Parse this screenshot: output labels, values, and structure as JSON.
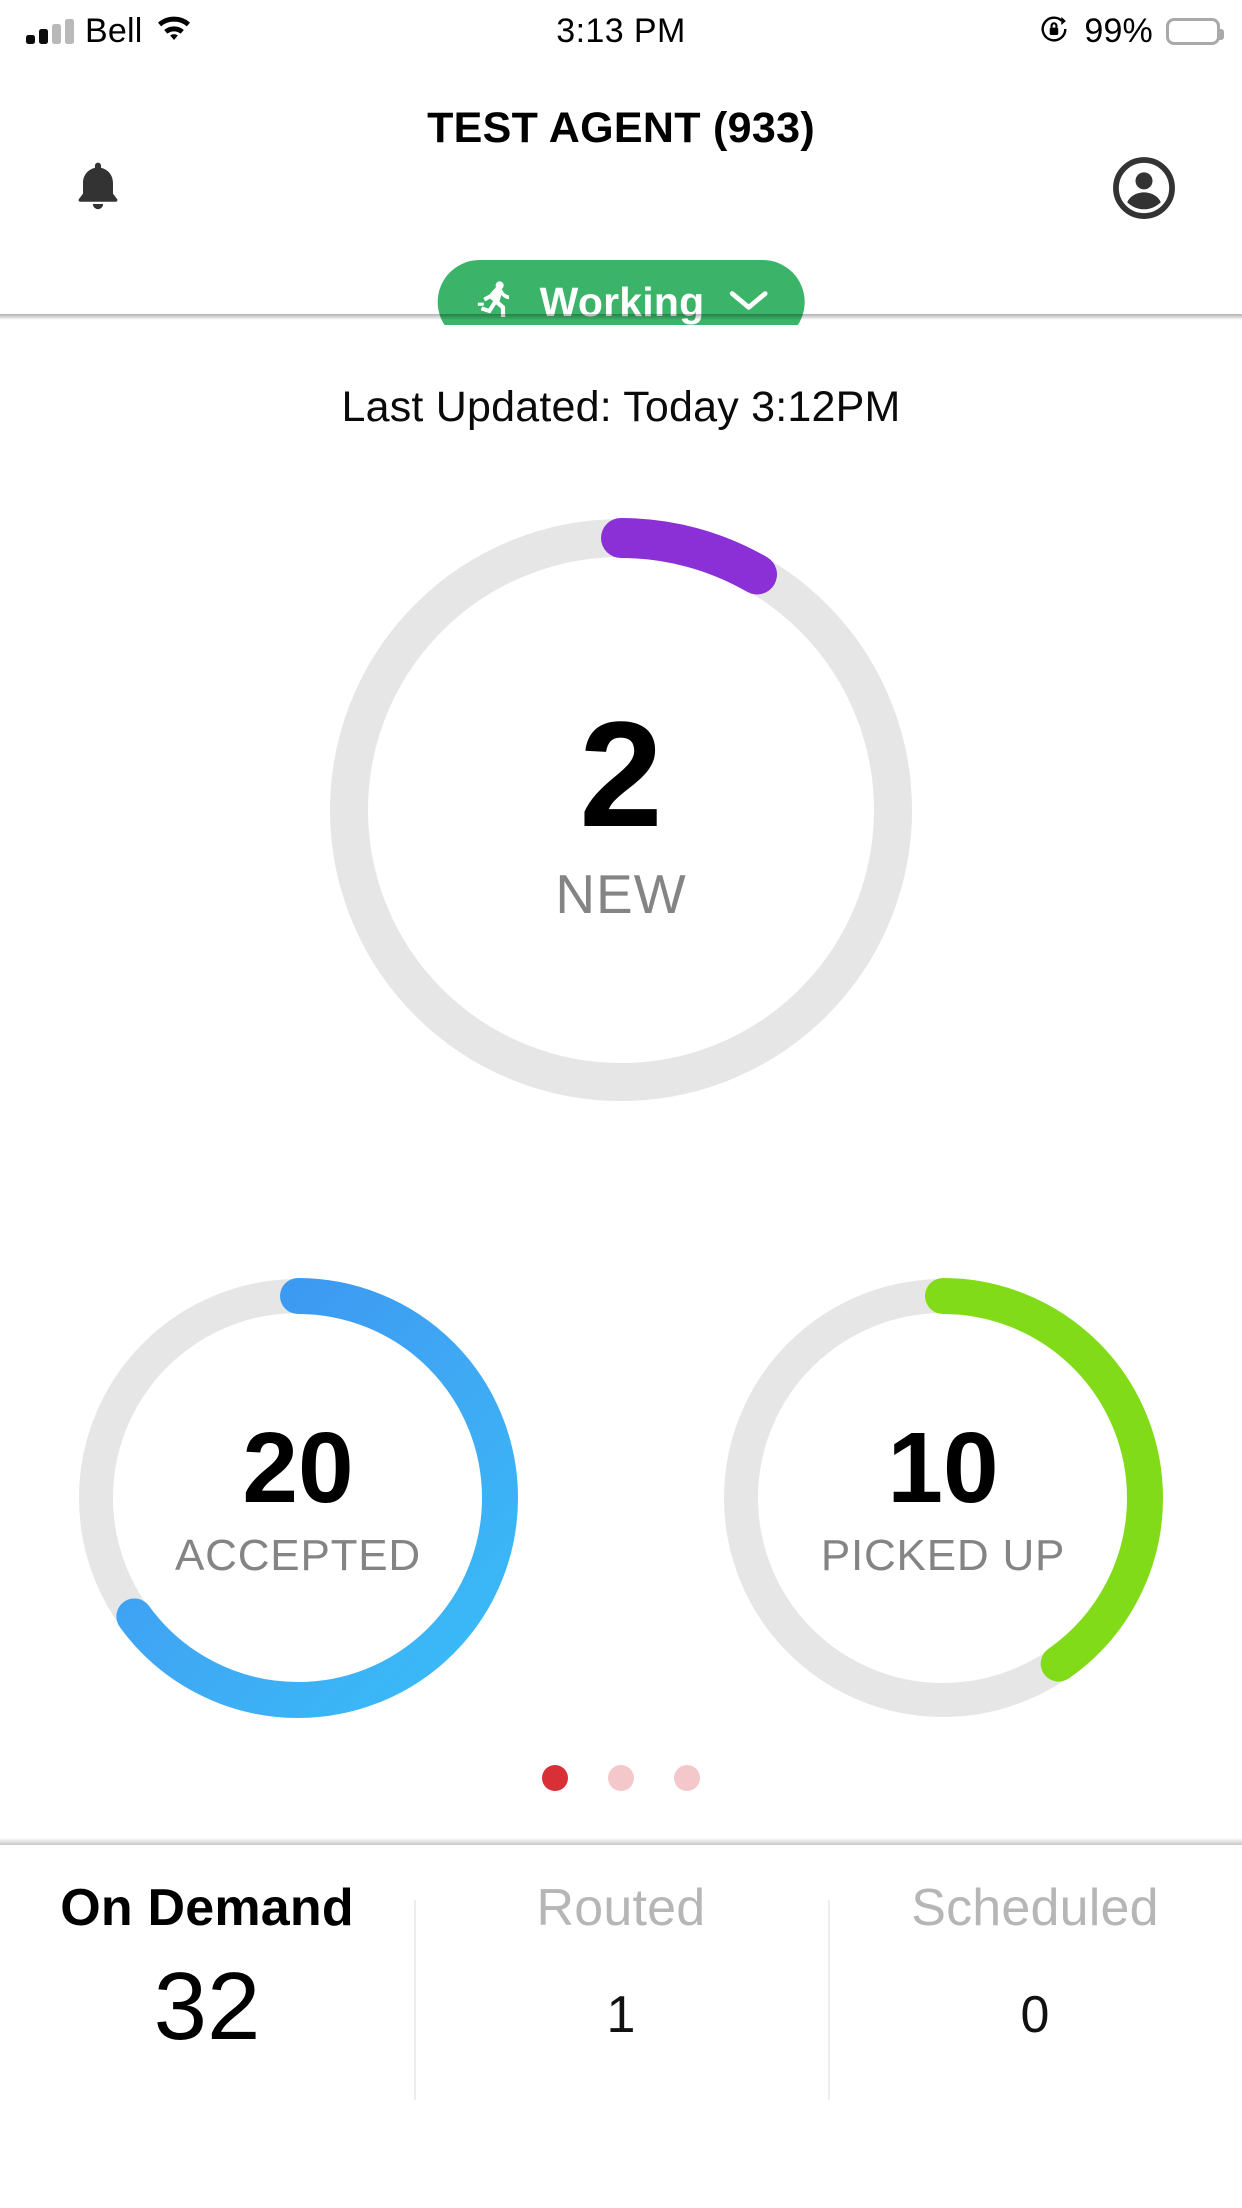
{
  "statusbar": {
    "carrier": "Bell",
    "time": "3:13 PM",
    "battery_pct": "99%",
    "signal_icon": "cellular-signal-icon",
    "wifi_icon": "wifi-icon",
    "orientation_lock_icon": "rotation-lock-icon",
    "battery_icon": "battery-icon"
  },
  "header": {
    "title": "TEST AGENT (933)",
    "bell_icon": "bell-icon",
    "account_icon": "account-circle-icon",
    "status": {
      "label": "Working",
      "icon": "running-person-icon",
      "chevron": "chevron-down-icon",
      "color": "#3bb368"
    }
  },
  "content": {
    "last_updated": "Last Updated: Today 3:12PM"
  },
  "chart_data": [
    {
      "type": "donut",
      "name": "new",
      "title": "NEW",
      "value": 2,
      "total": 32,
      "percent": 8.3,
      "arc_degrees": 30,
      "color": "#8B2FD6",
      "track_color": "#E6E6E6",
      "size": "large"
    },
    {
      "type": "donut",
      "name": "accepted",
      "title": "ACCEPTED",
      "value": 20,
      "total": 32,
      "percent": 65,
      "arc_degrees": 234,
      "color": "#3B8EF0",
      "color_end": "#38BDF8",
      "track_color": "#E6E6E6",
      "size": "small"
    },
    {
      "type": "donut",
      "name": "picked_up",
      "title": "PICKED UP",
      "value": 10,
      "total": 32,
      "percent": 40,
      "arc_degrees": 145,
      "color": "#82DB18",
      "track_color": "#E6E6E6",
      "size": "small"
    }
  ],
  "pager": {
    "count": 3,
    "active_index": 0,
    "active_color": "#D93038",
    "inactive_color": "#F4C8CB"
  },
  "bottom_tabs": [
    {
      "label": "On Demand",
      "value": "32",
      "active": true
    },
    {
      "label": "Routed",
      "value": "1",
      "active": false
    },
    {
      "label": "Scheduled",
      "value": "0",
      "active": false
    }
  ]
}
